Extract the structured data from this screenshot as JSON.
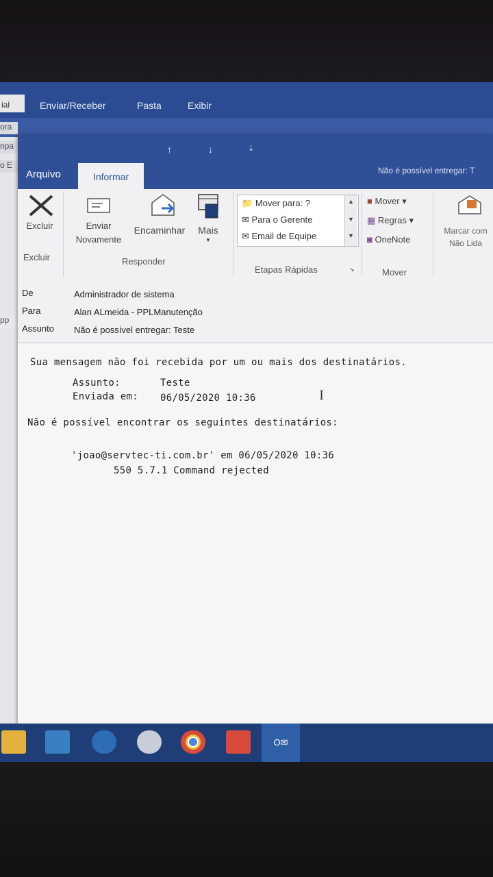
{
  "main_window": {
    "tabs": [
      "ial",
      "Enviar/Receber",
      "Pasta",
      "Exibir"
    ],
    "left_fragments": [
      "ora",
      "npa",
      "o E",
      "pp"
    ]
  },
  "message_window": {
    "title": "Não é possível entregar: T",
    "tabs": {
      "file": "Arquivo",
      "active": "Informar"
    },
    "ribbon": {
      "delete": {
        "button": "Excluir",
        "group": "Excluir"
      },
      "respond": {
        "resend_line1": "Enviar",
        "resend_line2": "Novamente",
        "forward": "Encaminhar",
        "more": "Mais",
        "group": "Responder"
      },
      "quick_steps": {
        "items": [
          "Mover para: ?",
          "Para o Gerente",
          "Email de Equipe"
        ],
        "group": "Etapas Rápidas"
      },
      "move": {
        "items": [
          "Mover ▾",
          "Regras ▾",
          "OneNote"
        ],
        "group": "Mover"
      },
      "mark_unread_line1": "Marcar com",
      "mark_unread_line2": "Não Lida"
    },
    "header": {
      "from_label": "De",
      "from_value": "Administrador de sistema",
      "to_label": "Para",
      "to_value": "Alan ALmeida - PPLManutenção",
      "subject_label": "Assunto",
      "subject_value": "Não é possível entregar: Teste"
    },
    "body": {
      "line1": "Sua mensagem não foi recebida por um ou mais dos destinatários.",
      "subject_key": "Assunto:",
      "subject_val": "Teste",
      "sent_key": "Enviada em:",
      "sent_val": "06/05/2020 10:36",
      "line2": "Não é possível encontrar os seguintes destinatários:",
      "recipient_line": "'joao@servtec-ti.com.br' em 06/05/2020 10:36",
      "error_line": "550 5.7.1 Command rejected"
    }
  },
  "taskbar": {
    "apps": [
      "file-explorer",
      "mail",
      "network",
      "cloud",
      "chrome",
      "remote-desktop",
      "outlook"
    ],
    "outlook_label": "O✉"
  },
  "colors": {
    "ribbon_blue": "#2f4f97",
    "taskbar": "#1f3e78"
  }
}
